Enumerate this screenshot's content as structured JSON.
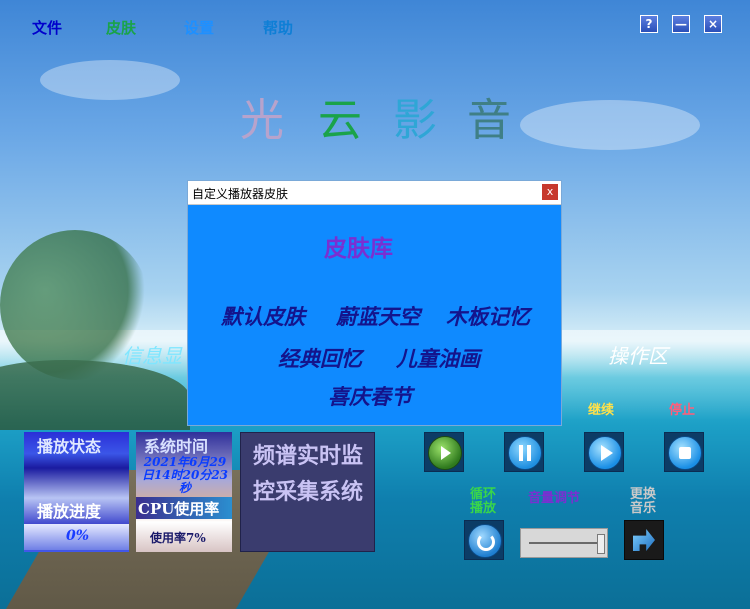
{
  "menu": {
    "items": [
      {
        "label": "文件",
        "color": "#0000cc"
      },
      {
        "label": "皮肤",
        "color": "#1aa34a"
      },
      {
        "label": "设置",
        "color": "#1e90ff"
      },
      {
        "label": "帮助",
        "color": "#0e7fd6"
      }
    ]
  },
  "window_controls": {
    "help": "?",
    "minimize": "—",
    "close": "×"
  },
  "app_title": {
    "chars": [
      {
        "ch": "光",
        "color": "#b7a3cc"
      },
      {
        "ch": "云",
        "color": "#1aa34a"
      },
      {
        "ch": "影",
        "color": "#2fa6d6"
      },
      {
        "ch": "音",
        "color": "#3f7f86"
      }
    ]
  },
  "side_labels": {
    "left": "信息显",
    "right": "操作区"
  },
  "dialog": {
    "title": "自定义播放器皮肤",
    "close": "x",
    "library_title": "皮肤库",
    "skins": [
      "默认皮肤",
      "蔚蓝天空",
      "木板记忆",
      "经典回忆",
      "儿童油画",
      "喜庆春节"
    ]
  },
  "status_panel": {
    "title": "播放状态",
    "progress_title": "播放进度",
    "progress_value": "0%"
  },
  "time_panel": {
    "title": "系统时间",
    "datetime": "2021年6月29日14时20分23秒",
    "cpu_title": "CPU使用率",
    "cpu_value": "使用率7%"
  },
  "spectrum_panel": {
    "text": "频谱实时监控采集系统"
  },
  "controls": {
    "continue_label": "继续",
    "stop_label": "停止",
    "loop_label": "循环播放",
    "volume_label": "音量调节",
    "change_label": "更换音乐"
  },
  "colors": {
    "accent": "#0f8aff",
    "continue": "#ffe14a",
    "stop": "#ff5e7a",
    "loop": "#39d64a",
    "volume": "#7b2fd1",
    "change": "#c9c9c9"
  }
}
